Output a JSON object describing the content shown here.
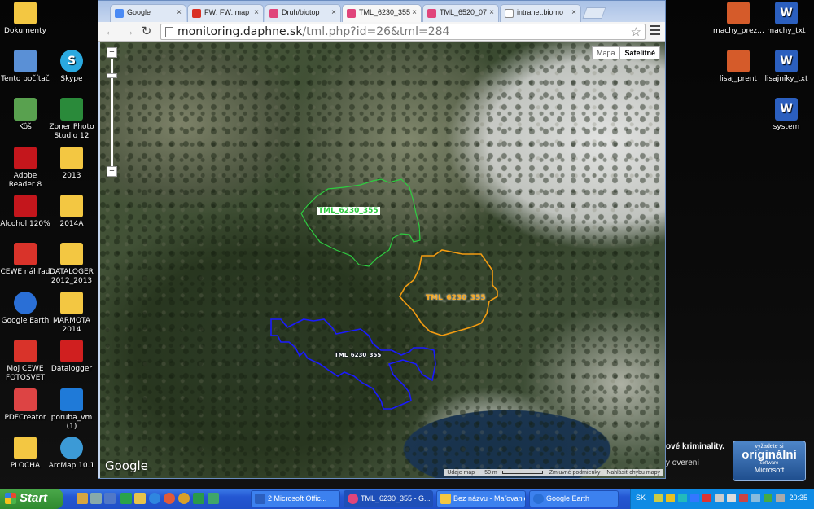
{
  "desktop": {
    "left_icons": [
      {
        "label": "Dokumenty",
        "color": "#f3c742"
      },
      {
        "label": "Tento počítač",
        "color": "#5a90d6"
      },
      {
        "label": "Skype",
        "color": "#2aa9e0"
      },
      {
        "label": "Kôš",
        "color": "#59a14f"
      },
      {
        "label": "Zoner Photo Studio 12",
        "color": "#2a8a3a"
      },
      {
        "label": "Adobe Reader 8",
        "color": "#c4161c"
      },
      {
        "label": "2013",
        "color": "#f3c742"
      },
      {
        "label": "Alcohol 120%",
        "color": "#c4161c"
      },
      {
        "label": "2014A",
        "color": "#f3c742"
      },
      {
        "label": "CEWE náhľad",
        "color": "#d9332a"
      },
      {
        "label": "DATALOGER 2012_2013",
        "color": "#f3c742"
      },
      {
        "label": "Google Earth",
        "color": "#2a6fd6"
      },
      {
        "label": "MARMOTA 2014",
        "color": "#f3c742"
      },
      {
        "label": "Moj CEWE FOTOSVET",
        "color": "#d9332a"
      },
      {
        "label": "Datalogger",
        "color": "#d01f1f"
      },
      {
        "label": "PDFCreator",
        "color": "#d44"
      },
      {
        "label": "poruba_vm (1)",
        "color": "#1f7ad8"
      },
      {
        "label": "PLOCHA",
        "color": "#f3c742"
      },
      {
        "label": "ArcMap 10.1",
        "color": "#3c9ad6"
      }
    ],
    "right_icons": [
      {
        "label": "machy_prez...",
        "color": "#d55b2a"
      },
      {
        "label": "machy_txt",
        "color": "#2b5fbf"
      },
      {
        "label": "lisaj_prent",
        "color": "#d55b2a"
      },
      {
        "label": "lisajniky_txt",
        "color": "#2b5fbf"
      },
      {
        "label": "system",
        "color": "#2b5fbf"
      }
    ]
  },
  "browser": {
    "tabs": [
      {
        "label": "Google",
        "color": "#4a8af4"
      },
      {
        "label": "FW: FW: map",
        "color": "#d93025"
      },
      {
        "label": "Druh/biotop",
        "color": "#e0457b"
      },
      {
        "label": "TML_6230_355",
        "color": "#e0457b"
      },
      {
        "label": "TML_6520_07",
        "color": "#e0457b"
      },
      {
        "label": "intranet.biomo",
        "color": "#ffffff"
      }
    ],
    "tab_close": "×",
    "url_host": "monitoring.daphne.sk",
    "url_path": "/tml.php?id=26&tml=284"
  },
  "map": {
    "type_buttons": [
      "Mapa",
      "Satelitné"
    ],
    "logo": "Google",
    "attribution": [
      "Údaje máp",
      "50 m",
      "Zmluvné podmienky",
      "Nahlásiť chybu mapy"
    ],
    "polygons": [
      {
        "label": "TML_6230_355",
        "color": "#2ecc40"
      },
      {
        "label": "TML_6230_355",
        "color": "#f39c12"
      },
      {
        "label": "TML_6230_355",
        "color": "#1a1aff"
      }
    ]
  },
  "watermark": {
    "line1": "ové kriminality.",
    "line2": "y overení",
    "genuine": [
      "vyžadete si",
      "originální",
      "software",
      "Microsoft"
    ]
  },
  "taskbar": {
    "start": "Start",
    "tasks": [
      {
        "label": "2 Microsoft Offic...",
        "color": "#2b5fbf"
      },
      {
        "label": "TML_6230_355 - G...",
        "color": "#e0457b"
      },
      {
        "label": "Bez názvu - Maľovanie",
        "color": "#f3c742"
      },
      {
        "label": "Google Earth",
        "color": "#2a6fd6"
      }
    ],
    "lang": "SK",
    "clock": "20:35"
  }
}
